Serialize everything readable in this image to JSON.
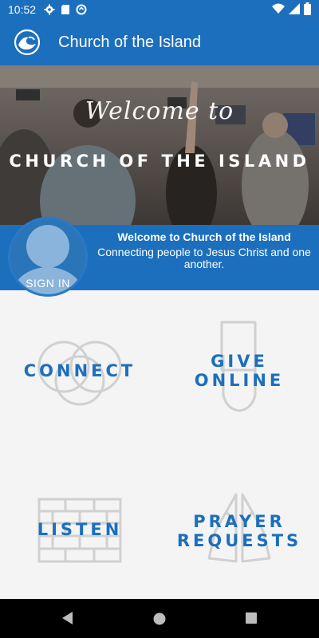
{
  "status_bar": {
    "time": "10:52",
    "left_icons": [
      "gear-icon",
      "sd-card-icon",
      "sync-icon"
    ],
    "right_icons": [
      "wifi-icon",
      "signal-icon",
      "battery-icon"
    ]
  },
  "app_bar": {
    "title": "Church of the Island",
    "logo_icon": "wave-logo-icon"
  },
  "hero": {
    "script_text": "Welcome to",
    "title": "CHURCH OF THE ISLAND"
  },
  "welcome": {
    "title": "Welcome to Church of the Island",
    "subtitle": "Connecting people to Jesus Christ and one another."
  },
  "avatar": {
    "sign_in_label": "SIGN IN"
  },
  "tiles": [
    {
      "label_lines": [
        "CONNECT"
      ],
      "icon": "rings-icon"
    },
    {
      "label_lines": [
        "GIVE",
        "ONLINE"
      ],
      "icon": "hand-icon"
    },
    {
      "label_lines": [
        "LISTEN"
      ],
      "icon": "brick-wall-icon"
    },
    {
      "label_lines": [
        "PRAYER",
        "REQUESTS"
      ],
      "icon": "praying-hands-icon"
    }
  ],
  "colors": {
    "brand_blue": "#1c6fbd",
    "page_background": "#f4f4f4",
    "icon_gray": "#d0d0d0"
  },
  "nav_bar": {
    "buttons": [
      "back-icon",
      "home-icon",
      "recents-icon"
    ]
  }
}
